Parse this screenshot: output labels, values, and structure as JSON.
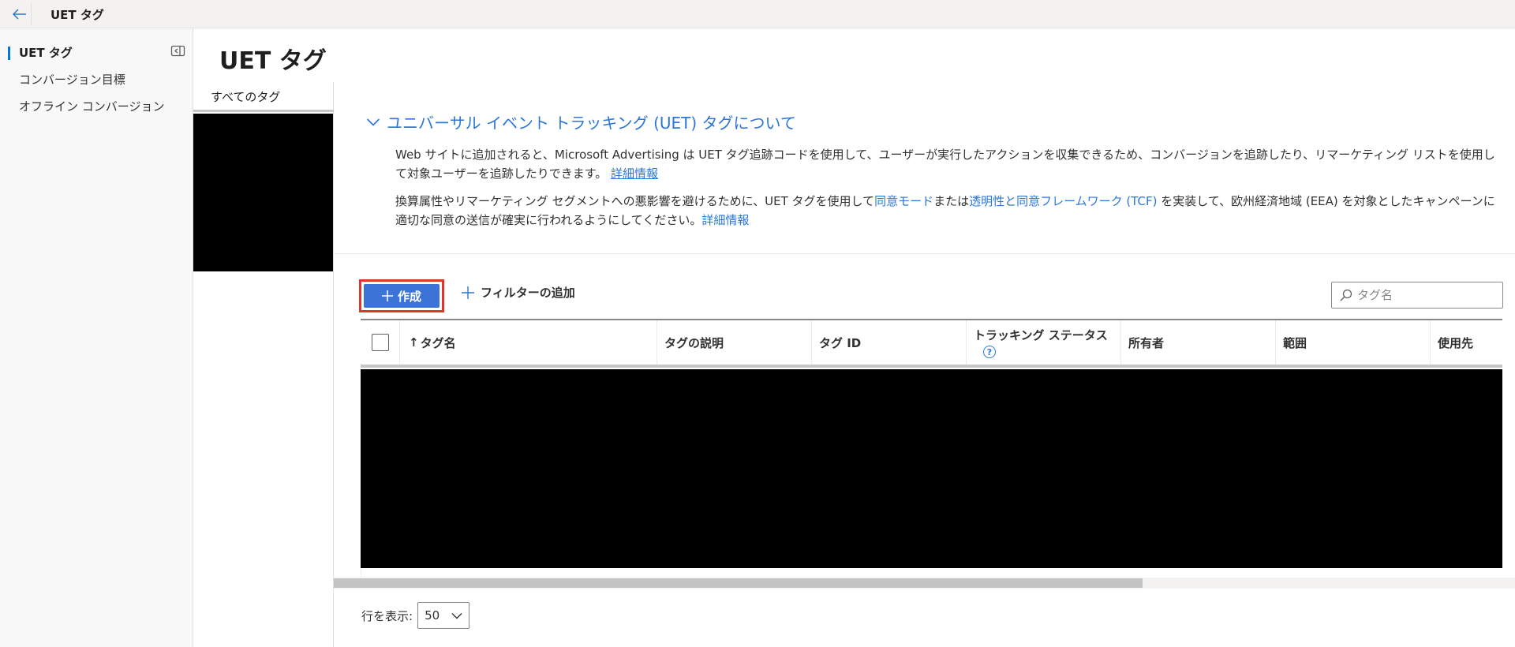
{
  "topbar": {
    "title": "UET タグ"
  },
  "sidebar": {
    "items": [
      {
        "label": "UET タグ"
      },
      {
        "label": "コンバージョン目標"
      },
      {
        "label": "オフライン コンバージョン"
      }
    ]
  },
  "page": {
    "title": "UET タグ"
  },
  "left_panel": {
    "tab_label": "すべてのタグ"
  },
  "info": {
    "accordion_label": "ユニバーサル イベント トラッキング (UET) タグについて",
    "para1_text": "Web サイトに追加されると、Microsoft Advertising は UET タグ追跡コードを使用して、ユーザーが実行したアクションを収集できるため、コンバージョンを追跡したり、リマーケティング リストを使用して対象ユーザーを追跡したりできます。",
    "para1_link": "詳細情報",
    "para2_part1": "換算属性やリマーケティング セグメントへの悪影響を避けるために、UET タグを使用して",
    "para2_link1": "同意モード",
    "para2_part2": "または",
    "para2_link2": "透明性と同意フレームワーク (TCF)",
    "para2_part3": " を実装して、欧州経済地域 (EEA) を対象としたキャンペーンに適切な同意の送信が確実に行われるようにしてください。",
    "para2_link3": "詳細情報"
  },
  "toolbar": {
    "create_label": "作成",
    "filter_label": "フィルターの追加",
    "search_placeholder": "タグ名"
  },
  "table": {
    "columns": {
      "sort_arrow": "↑",
      "tag_name": "タグ名",
      "description": "タグの説明",
      "tag_id": "タグ ID",
      "tracking_status": "トラッキング ステータス",
      "owner": "所有者",
      "scope": "範囲",
      "used_by": "使用先"
    },
    "help_glyph": "?"
  },
  "pager": {
    "label": "行を表示:",
    "value": "50"
  }
}
